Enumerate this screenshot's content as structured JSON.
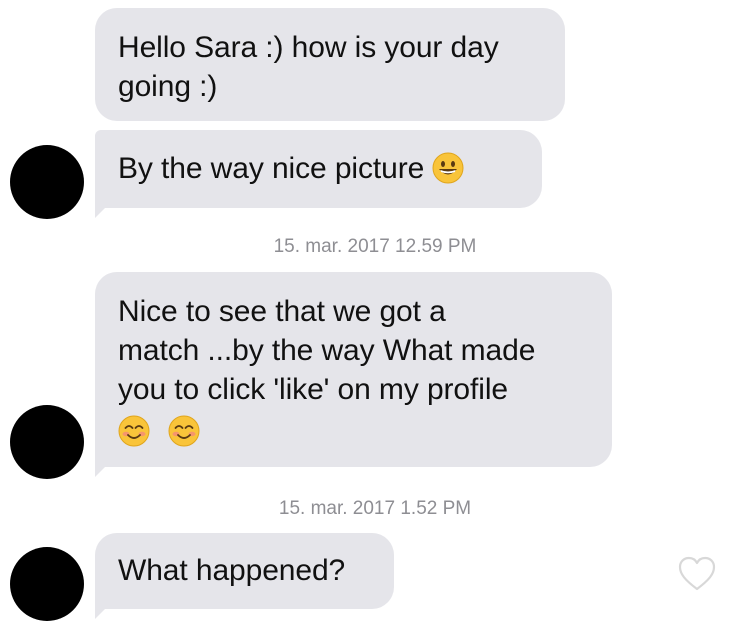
{
  "messages": [
    {
      "text": "Hello Sara :) how is your day going :)",
      "line1": "Hello Sara :) how is your day",
      "line2": "going :)"
    },
    {
      "text": "By the way nice picture",
      "emoji": "grinning-face-emoji"
    },
    {
      "line1": "Nice to see that we got a",
      "line2": "match ...by the way What made",
      "line3": "you to click 'like' on my profile",
      "emojis": [
        "smiling-face-with-smiling-eyes-emoji",
        "smiling-face-with-smiling-eyes-emoji"
      ]
    },
    {
      "text": "What happened?"
    }
  ],
  "timestamps": [
    "15. mar. 2017 12.59 PM",
    "15. mar. 2017 1.52 PM"
  ],
  "icons": {
    "like": "heart-outline-icon"
  },
  "colors": {
    "bubble": "#e5e5ea",
    "avatar": "#000000",
    "timestamp": "#8e8e93",
    "heart": "#d8d8d8"
  }
}
